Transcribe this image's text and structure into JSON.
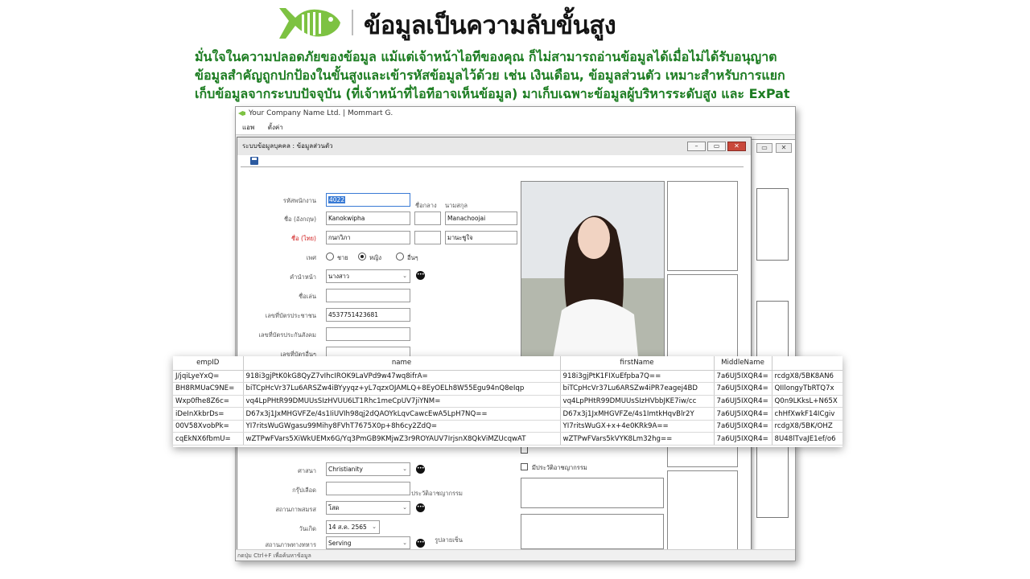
{
  "header": {
    "title": "ข้อมูลเป็นความลับขั้นสูง",
    "lines": [
      "มั่นใจในความปลอดภัยของข้อมูล   แม้แต่เจ้าหน้าไอทีของคุณ   ก็ไม่สามารถอ่านข้อมูลได้เมื่อไม่ได้รับอนุญาต",
      "ข้อมูลสำคัญถูกปกป้องในขั้นสูงและเข้ารหัสข้อมูลไว้ด้วย เช่น เงินเดือน, ข้อมูลส่วนตัว เหมาะสำหรับการแยก",
      "เก็บข้อมูลจากระบบปัจจุบัน (ที่เจ้าหน้าที่ไอทีอาจเห็นข้อมูล) มาเก็บเฉพาะข้อมูลผู้บริหารระดับสูง และ ExPat"
    ],
    "brand_color": "#7dc242",
    "text_color": "#1d7d22"
  },
  "app": {
    "title": "Your Company Name Ltd. | Mommart G.",
    "menu": [
      "แอพ",
      "ตั้งค่า"
    ],
    "status": "กดปุ่ม Ctrl+F เพื่อค้นหาข้อมูล"
  },
  "form": {
    "title": "ระบบข้อมูลบุคคล : ข้อมูลส่วนตัว",
    "labels": {
      "emp_code": "รหัสพนักงาน",
      "middle": "ชื่อกลาง",
      "surname": "นามสกุล",
      "name_en": "ชื่อ (อังกฤษ)",
      "name_th": "ชื่อ (ไทย)",
      "gender": "เพศ",
      "title": "คำนำหน้า",
      "nickname": "ชื่อเล่น",
      "id_card": "เลขที่บัตรประชาชน",
      "social": "เลขที่บัตรประกันสังคม",
      "other_id": "เลขที่บัตรอื่นๆ",
      "religion": "ศาสนา",
      "blood": "กรุ๊ปเลือด",
      "marital": "สถานภาพสมรส",
      "birthdate": "วันเกิด",
      "military": "สถานภาพทางทหาร",
      "criminal": "ประวัติอาชญากรรม",
      "signature": "รูปลายเซ็น"
    },
    "values": {
      "emp_code": "4022",
      "first_en": "Kanokwipha",
      "last_en": "Manachoojai",
      "first_th": "กนกวิภา",
      "last_th": "มานะชูใจ",
      "title": "นางสาว",
      "id_card": "4537751423681",
      "religion": "Christianity",
      "marital": "โสด",
      "birthdate": "14 ส.ค.   2565",
      "military": "Serving"
    },
    "gender_options": [
      "ชาย",
      "หญิง",
      "อื่นๆ"
    ],
    "gender_selected": "หญิง",
    "checkboxes": [
      "มีประวัติอาชญากรรม"
    ]
  },
  "grid": {
    "columns": [
      "empID",
      "name",
      "firstName",
      "MiddleName",
      ""
    ],
    "rows": [
      [
        "J/jqiLyeYxQ=",
        "918i3gjPtK0kG8QyZ7vIhcIROK9LaVPd9w47wq8ifrA=",
        "918i3gjPtK1FIXuEfpba7Q==",
        "7a6UJ5IXQR4=",
        "rcdgX8/5BK8AN6"
      ],
      [
        "BH8RMUaC9NE=",
        "biTCpHcVr37Lu6ARSZw4iBYyyqz+yL7qzxOJAMLQ+8EyOELh8W55Egu94nQ8eIqp",
        "biTCpHcVr37Lu6ARSZw4iPR7eagej4BD",
        "7a6UJ5IXQR4=",
        "QIIlongyTbRTQ7x"
      ],
      [
        "Wxp0fhe8Z6c=",
        "vq4LpPHtR99DMUUsSIzHVUU6LT1Rhc1meCpUV7jiYNM=",
        "vq4LpPHtR99DMUUsSIzHVbbJKE7iw/cc",
        "7a6UJ5IXQR4=",
        "Q0n9LKksL+N65X"
      ],
      [
        "iDeInXkbrDs=",
        "D67x3j1JxMHGVFZe/4s1IiUVIh98qj2dQAOYkLqvCawcEwA5LpH7NQ==",
        "D67x3j1JxMHGVFZe/4s1ImtkHqvBlr2Y",
        "7a6UJ5IXQR4=",
        "chHfXwkF14ICgiv"
      ],
      [
        "00V58XvobPk=",
        "YI7ritsWuGWgasu99Mihy8FVhT7675X0p+8h6cy2ZdQ=",
        "YI7ritsWuGX+x+4e0KRk9A==",
        "7a6UJ5IXQR4=",
        "rcdgX8/5BK/OHZ"
      ],
      [
        "cqEkNX6fbmU=",
        "wZTPwFVars5XiWkUEMx6G/Yq3PmGB9KMjwZ3r9ROYAUV7IrjsnX8QkViMZUcqwAT",
        "wZTPwFVars5kVYK8Lm32hg==",
        "7a6UJ5IXQR4=",
        "8U48lTvaJE1ef/o6"
      ]
    ]
  }
}
